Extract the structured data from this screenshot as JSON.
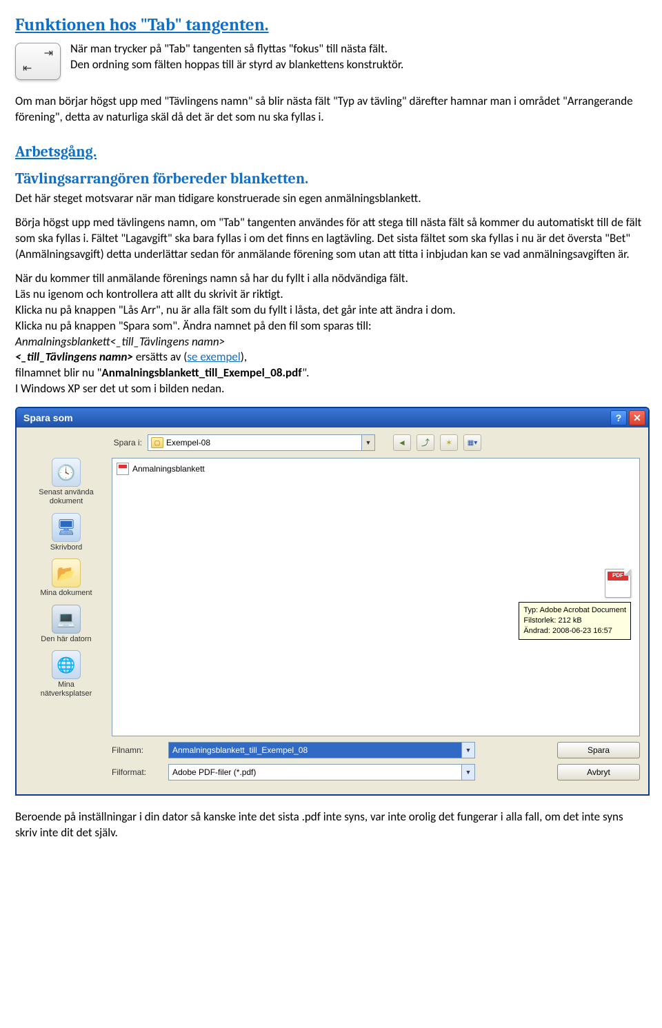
{
  "heading1": "Funktionen hos \"Tab\" tangenten.",
  "tab_para1": "När man trycker på \"Tab\" tangenten så flyttas \"fokus\" till nästa fält.",
  "tab_para2": "Den ordning som fälten hoppas till är styrd av blankettens konstruktör.",
  "tab_para3": "Om man börjar högst upp med \"Tävlingens namn\" så blir nästa fält \"Typ av tävling\" därefter hamnar man i området \"Arrangerande förening\", detta av naturliga skäl då det är det som nu ska fyllas i.",
  "heading2": "Arbetsgång.",
  "heading3": "Tävlingsarrangören förbereder blanketten.",
  "p_prep": "Det här steget motsvarar när man tidigare konstruerade sin egen anmälningsblankett.",
  "p_main1": "Börja högst upp med tävlingens namn, om \"Tab\" tangenten användes för att stega till nästa fält så kommer du automatiskt till de fält som ska fyllas i. Fältet \"Lagavgift\" ska bara fyllas i om det finns en lagtävling. Det sista fältet som ska fyllas i nu är det översta \"Bet\" (Anmälningsavgift) detta underlättar sedan för anmälande förening som utan att titta i inbjudan kan se vad anmälningsavgiften är.",
  "p_main2a": "När du kommer till anmälande förenings namn så har du fyllt i alla nödvändiga fält.",
  "p_main2b": "Läs nu igenom och kontrollera att allt du skrivit är riktigt.",
  "p_main2c": "Klicka nu på knappen \"Lås Arr\", nu är alla fält som du fyllt i låsta, det går inte att ändra i dom.",
  "p_main2d": "Klicka nu på knappen \"Spara som\". Ändra namnet på den fil som sparas till:",
  "p_fname_tpl": "Anmalningsblankett<_till_Tävlingens namn>",
  "p_replace_a": "<_till_Tävlingens namn>",
  "p_replace_b": " ersätts av (",
  "p_replace_link": "se exempel",
  "p_replace_c": "),",
  "p_result_a": "filnamnet blir nu \"",
  "p_result_b": "Anmalningsblankett_till_Exempel_08.pdf",
  "p_result_c": "\".",
  "p_xp": "I Windows XP ser det ut som i bilden nedan.",
  "p_after": "Beroende på inställningar i din dator så kanske inte det sista .pdf inte syns, var inte orolig det fungerar i alla fall, om det inte syns skriv inte dit det själv.",
  "dlg": {
    "title": "Spara som",
    "save_in_label": "Spara i:",
    "folder": "Exempel-08",
    "file_item": "Anmalningsblankett",
    "places": {
      "recent": "Senast använda\ndokument",
      "desktop": "Skrivbord",
      "docs": "Mina dokument",
      "computer": "Den här datorn",
      "network": "Mina\nnätverksplatser"
    },
    "tooltip": {
      "l1": "Typ: Adobe Acrobat Document",
      "l2": "Filstorlek: 212 kB",
      "l3": "Ändrad: 2008-06-23 16:57"
    },
    "filename_label": "Filnamn:",
    "filename_value": "Anmalningsblankett_till_Exempel_08",
    "filetype_label": "Filformat:",
    "filetype_value": "Adobe PDF-filer (*.pdf)",
    "save_btn": "Spara",
    "cancel_btn": "Avbryt"
  }
}
